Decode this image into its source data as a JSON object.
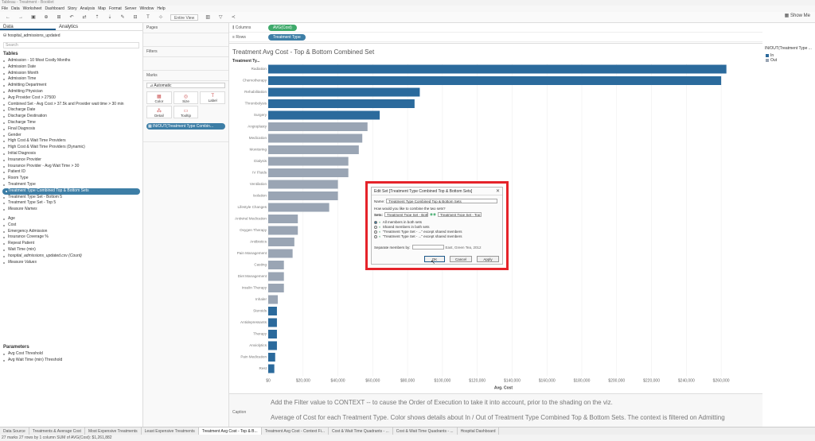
{
  "window": {
    "title": "Tableau - Treatment - Booklet"
  },
  "menu": [
    "File",
    "Data",
    "Worksheet",
    "Dashboard",
    "Story",
    "Analysis",
    "Map",
    "Format",
    "Server",
    "Window",
    "Help"
  ],
  "toolbar": {
    "view": "Entire View",
    "show_me": "Show Me"
  },
  "left_panel": {
    "tabs": [
      "Data",
      "Analytics"
    ],
    "datasource": "hospital_admissions_updated",
    "search_placeholder": "Search",
    "tables_header": "Tables",
    "fields": [
      "Admission - 10 Most Costly Months",
      "Admission Date",
      "Admission Month",
      "Admission Time",
      "Admitting Department",
      "Admitting Physician",
      "Avg Provider Cost > 27500",
      "Combined Set - Avg Cost > 37.5k and Provider wait time > 30 min",
      "Discharge Date",
      "Discharge Destination",
      "Discharge Time",
      "Final Diagnosis",
      "Gender",
      "High Cost & Wait Time Providers",
      "High Cost & Wait Time Providers (Dynamic)",
      "Initial Diagnosis",
      "Insurance Provider",
      "Insurance Provider - Avg Wait Time > 30",
      "Patient ID",
      "Room Type",
      "Treatment Type",
      "Treatment Type Combined Top & Bottom Sets",
      "Treatment Type Set - Bottom 5",
      "Treatment Type Set - Top 5",
      "Measure Names"
    ],
    "selected_field_index": 21,
    "measures": [
      "Age",
      "Cost",
      "Emergency Admission",
      "Insurance Coverage %",
      "Repeat Patient",
      "Wait Time (min)",
      "hospital_admissions_updated.csv (Count)",
      "Measure Values"
    ],
    "parameters_header": "Parameters",
    "parameters": [
      "Avg Cost Threshold",
      "Avg Wait Time (min) Threshold"
    ]
  },
  "cards": {
    "pages": "Pages",
    "filters": "Filters",
    "marks": "Marks",
    "mark_type": "Automatic",
    "mark_buttons": [
      {
        "label": "Color",
        "icon": "color-icon",
        "glyph": "▦"
      },
      {
        "label": "Size",
        "icon": "size-icon",
        "glyph": "◎"
      },
      {
        "label": "Label",
        "icon": "label-icon",
        "glyph": "T"
      },
      {
        "label": "Detail",
        "icon": "detail-icon",
        "glyph": "⁂"
      },
      {
        "label": "Tooltip",
        "icon": "tooltip-icon",
        "glyph": "▭"
      }
    ],
    "mark_pill": "IN/OUT(Treatment Type Combin..."
  },
  "shelves": {
    "columns_label": "Columns",
    "columns_pill": "AVG(Cost)",
    "rows_label": "Rows",
    "rows_pill": "Treatment Type"
  },
  "colors": {
    "in": "#2b6a9c",
    "out": "#9aa5b4",
    "pill_measure": "#3faa6b",
    "pill_dim": "#3d7ea6",
    "highlight": "#e5232a"
  },
  "chart_data": {
    "type": "bar",
    "title": "Treatment Avg Cost - Top & Bottom Combined Set",
    "row_header": "Treatment Ty...",
    "xlabel": "Avg. Cost",
    "xlim": [
      0,
      270000
    ],
    "ticks": [
      "$0",
      "$20,000",
      "$40,000",
      "$60,000",
      "$80,000",
      "$100,000",
      "$120,000",
      "$140,000",
      "$160,000",
      "$180,000",
      "$200,000",
      "$220,000",
      "$240,000",
      "$260,000"
    ],
    "tick_values": [
      0,
      20000,
      40000,
      60000,
      80000,
      100000,
      120000,
      140000,
      160000,
      180000,
      200000,
      220000,
      240000,
      260000
    ],
    "categories": [
      "Radiation",
      "Chemotherapy",
      "Rehabilitation",
      "Thrombolysis",
      "Surgery",
      "Angioplasty",
      "Medication",
      "Monitoring",
      "Dialysis",
      "IV Fluids",
      "Ventilation",
      "Isolation",
      "Lifestyle Changes",
      "Antiviral Medication",
      "Oxygen Therapy",
      "Antibiotics",
      "Pain Management",
      "Casting",
      "Diet Management",
      "Insulin Therapy",
      "Inhaler",
      "Steroids",
      "Antidepressants",
      "Therapy",
      "Anxiolytics",
      "Pain Medication",
      "Rest"
    ],
    "values": [
      263000,
      260000,
      87000,
      84000,
      64000,
      57000,
      54000,
      52000,
      46000,
      46000,
      40000,
      40000,
      35000,
      17000,
      17000,
      15000,
      14000,
      9000,
      9000,
      9000,
      5500,
      5000,
      5000,
      5000,
      5000,
      4000,
      3500
    ],
    "group": [
      "In",
      "In",
      "In",
      "In",
      "In",
      "Out",
      "Out",
      "Out",
      "Out",
      "Out",
      "Out",
      "Out",
      "Out",
      "Out",
      "Out",
      "Out",
      "Out",
      "Out",
      "Out",
      "Out",
      "Out",
      "In",
      "In",
      "In",
      "In",
      "In",
      "In"
    ]
  },
  "legend": {
    "title": "IN/OUT(Treatment Type ...",
    "items": [
      "In",
      "Out"
    ]
  },
  "dialog": {
    "title": "Edit Set [Treatment Type Combined Top & Bottom Sets]",
    "name_label": "Name:",
    "name_value": "Treatment Type Combined Top & Bottom Sets",
    "question": "How would you like to combine the two sets?",
    "sets_label": "Sets:",
    "set1": "Treatment Type Set - Botto...",
    "set2": "Treatment Type Set - Top 5",
    "options": [
      "All members in both sets",
      "Shared members in both sets",
      "\"Treatment Type Set - ...\" except shared members",
      "\"Treatment Type Set - ...\" except shared members"
    ],
    "selected_option": 0,
    "separate_label": "Separate members by:",
    "example": "East, Green Tea, 2012",
    "ok": "OK",
    "cancel": "Cancel",
    "apply": "Apply"
  },
  "caption": {
    "label": "Caption",
    "line1": "Add the Filter value to CONTEXT -- to cause the Order of Execution to take it into account, prior to the shading on the viz.",
    "line2": "Average of Cost for each Treatment Type.  Color shows details about In / Out of Treatment Type Combined Top & Bottom Sets. The context is filtered on Admitting"
  },
  "sheet_tabs": [
    "Data Source",
    "Treatments & Average Cost",
    "Most Expensive Treatments",
    "Least Expensive Treatments",
    "Treatment Avg Cost - Top & B...",
    "Treatment Avg Cost - Context Fi...",
    "Cost & Wait Time Quadrants - ...",
    "Cost & Wait Time Quadrants - ...",
    "Hospital Dashboard"
  ],
  "active_sheet_index": 4,
  "status": "27 marks    27 rows by 1 column    SUM of AVG(Cost): $1,261,882"
}
